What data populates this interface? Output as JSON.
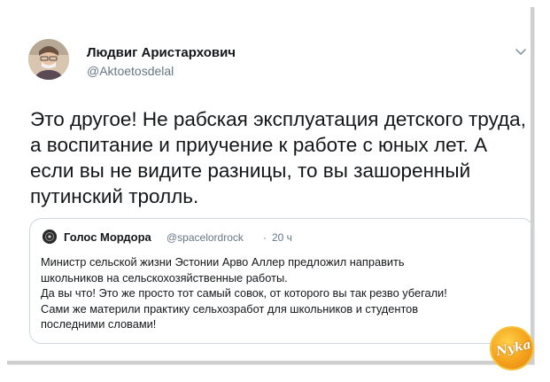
{
  "tweet": {
    "author_name": "Людвиг Аристархович",
    "author_handle": "@Aktoetosdelal",
    "text_lines": [
      "Это другое! Не рабская эксплуатация детского труда,",
      "а воспитание и приучение к работе с юных лет. А",
      "если вы не видите разницы, то вы зашоренный",
      "путинский тролль."
    ],
    "menu_icon": "chevron-down-icon"
  },
  "quoted_tweet": {
    "author_name": "Голос Мордора",
    "author_handle": "@spacelordrock",
    "separator": "·",
    "time": "20 ч",
    "text_lines": [
      "Министр сельской жизни Эстонии Арво Аллер предложил направить",
      "школьников на сельскохозяйственные работы.",
      "Да вы что! Это же просто тот самый совок, от которого вы так резво убегали!",
      "Сами же материли практику сельхозработ для школьников и студентов",
      "последними словами!"
    ]
  },
  "watermark": {
    "text": "Nyka",
    "colors": {
      "fill": "#f4a21c",
      "rim": "#f7c23a"
    }
  },
  "colors": {
    "primary_text": "#14171a",
    "secondary_text": "#657786",
    "border": "#ccd6dd"
  }
}
